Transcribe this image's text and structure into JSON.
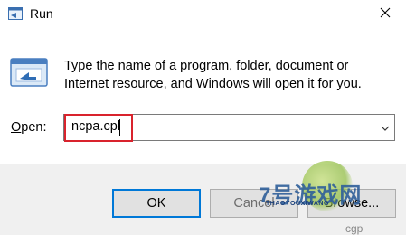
{
  "titlebar": {
    "title": "Run",
    "icon": "run-app-icon",
    "close_icon": "close-icon"
  },
  "content": {
    "icon": "run-program-icon",
    "description": "Type the name of a program, folder, document or Internet resource, and Windows will open it for you.",
    "open_label_mnemonic": "O",
    "open_label_rest": "pen:",
    "input_value": "ncpa.cpl",
    "dropdown_icon": "chevron-down-icon"
  },
  "buttons": {
    "ok": "OK",
    "cancel": "Cancel",
    "browse": "Browse..."
  },
  "watermark": {
    "logo": "7号游戏网",
    "sub": "THAOYOUXIWANG",
    "tail": "cgp"
  },
  "colors": {
    "highlight": "#d9232d",
    "ok_border": "#0078d7",
    "background": "#ffffff",
    "footer": "#f0f0f0"
  }
}
